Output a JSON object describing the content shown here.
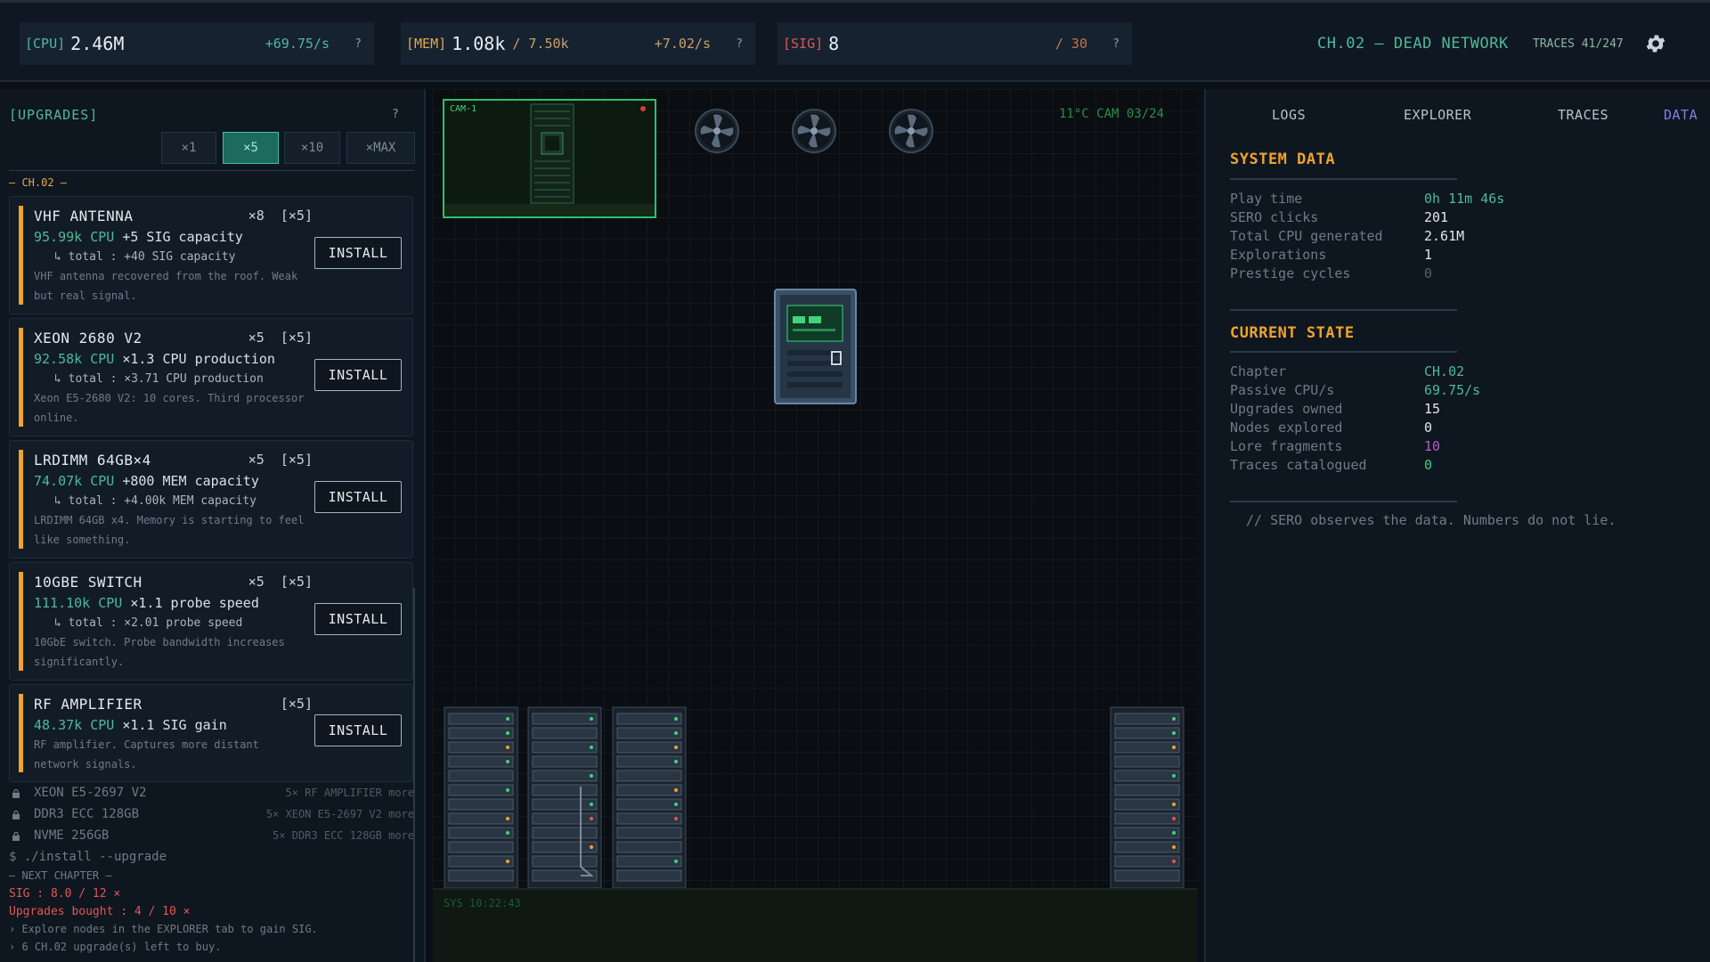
{
  "topbar": {
    "cpu": {
      "tag": "[CPU]",
      "value": "2.46M",
      "rate": "+69.75/s",
      "help": "?"
    },
    "mem": {
      "tag": "[MEM]",
      "value": "1.08k",
      "cap": "/ 7.50k",
      "rate": "+7.02/s",
      "help": "?"
    },
    "sig": {
      "tag": "[SIG]",
      "value": "8",
      "cap": "/ 30",
      "help": "?"
    },
    "chapter_title": "CH.02 — DEAD NETWORK",
    "traces": "TRACES 41/247",
    "settings_icon": "gear-icon"
  },
  "upgrades": {
    "title": "[UPGRADES]",
    "help": "?",
    "multipliers": [
      "×1",
      "×5",
      "×10",
      "×MAX"
    ],
    "active_multiplier": "×5",
    "chapter_label": "— CH.02 —",
    "install_label": "INSTALL",
    "cards": [
      {
        "name": "VHF ANTENNA",
        "owned": "×8",
        "batch": "[×5]",
        "cost": "95.99k CPU",
        "effect": "+5 SIG capacity",
        "total": "↳ total : +40 SIG capacity",
        "desc": "VHF antenna recovered from the roof. Weak but real signal."
      },
      {
        "name": "XEON 2680 V2",
        "owned": "×5",
        "batch": "[×5]",
        "cost": "92.58k CPU",
        "effect": "×1.3 CPU production",
        "total": "↳ total : ×3.71 CPU production",
        "desc": "Xeon E5-2680 V2: 10 cores. Third processor online."
      },
      {
        "name": "LRDIMM 64GB×4",
        "owned": "×5",
        "batch": "[×5]",
        "cost": "74.07k CPU",
        "effect": "+800 MEM capacity",
        "total": "↳ total : +4.00k MEM capacity",
        "desc": "LRDIMM 64GB x4. Memory is starting to feel like something."
      },
      {
        "name": "10GBE SWITCH",
        "owned": "×5",
        "batch": "[×5]",
        "cost": "111.10k CPU",
        "effect": "×1.1 probe speed",
        "total": "↳ total : ×2.01 probe speed",
        "desc": "10GbE switch. Probe bandwidth increases significantly."
      },
      {
        "name": "RF AMPLIFIER",
        "owned": "",
        "batch": "[×5]",
        "cost": "48.37k CPU",
        "effect": "×1.1 SIG gain",
        "total": "",
        "desc": "RF amplifier. Captures more distant network signals."
      }
    ],
    "locked": [
      {
        "name": "XEON E5-2697 V2",
        "req": "5× RF AMPLIFIER more"
      },
      {
        "name": "DDR3 ECC 128GB",
        "req": "5× XEON E5-2697 V2 more"
      },
      {
        "name": "NVME 256GB",
        "req": "5× DDR3 ECC 128GB more"
      }
    ],
    "install_cmd": "$ ./install --upgrade",
    "next_chapter": "— NEXT CHAPTER —",
    "sig_progress": "SIG : 8.0 / 12 ×",
    "upg_progress": "Upgrades bought : 4 / 10 ×",
    "hints": [
      "› Explore nodes in the EXPLORER tab to gain SIG.",
      "› 6 CH.02 upgrade(s) left to buy."
    ]
  },
  "scene": {
    "cam_label": "CAM-1",
    "readout": "11°C  CAM 03/24",
    "sys_clock": "SYS  10:22:43"
  },
  "right": {
    "tabs": [
      "LOGS",
      "EXPLORER",
      "TRACES",
      "DATA"
    ],
    "active_tab": "DATA",
    "system_title": "SYSTEM DATA",
    "system_rows": [
      {
        "k": "Play time",
        "v": "0h 11m 46s"
      },
      {
        "k": "SERO clicks",
        "v": "201"
      },
      {
        "k": "Total CPU generated",
        "v": "2.61M"
      },
      {
        "k": "Explorations",
        "v": "1"
      },
      {
        "k": "Prestige cycles",
        "v": "0"
      }
    ],
    "state_title": "CURRENT STATE",
    "state_rows": [
      {
        "k": "Chapter",
        "v": "CH.02"
      },
      {
        "k": "Passive CPU/s",
        "v": "69.75/s"
      },
      {
        "k": "Upgrades owned",
        "v": "15"
      },
      {
        "k": "Nodes explored",
        "v": "0"
      },
      {
        "k": "Lore fragments",
        "v": "10"
      },
      {
        "k": "Traces catalogued",
        "v": "0"
      }
    ],
    "note": "// SERO observes the data. Numbers do not lie."
  },
  "colors": {
    "accent": "#4fb89b",
    "warning": "#f0a32b",
    "danger": "#e0574f",
    "data_tab": "#8a7ce0"
  }
}
